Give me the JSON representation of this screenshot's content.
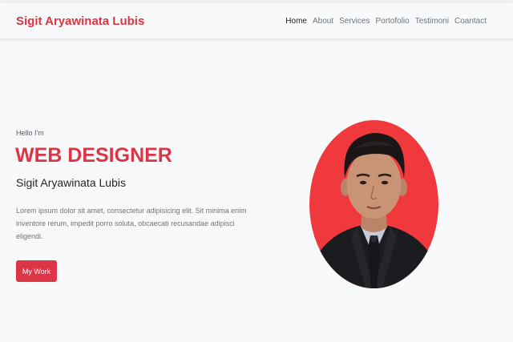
{
  "navbar": {
    "brand": "Sigit Aryawinata Lubis",
    "links": [
      "Home",
      "About",
      "Services",
      "Portofolio",
      "Testimoni",
      "Coantact"
    ]
  },
  "hero": {
    "greeting": "Hello I'm",
    "headline": "WEB DESIGNER",
    "name": "Sigit Aryawinata Lubis",
    "description": "Lorem ipsum dolor sit amet, consectetur adipisicing elit. Sit minima enim inventore rerum, impedit porro soluta, obcaecati recusandae adipisci eligendi.",
    "button_label": "My Work"
  },
  "colors": {
    "accent": "#dc3545",
    "photo_background": "#f0393c",
    "page_background": "#f8f9fa"
  },
  "icons": {
    "portrait": "profile-photo"
  }
}
